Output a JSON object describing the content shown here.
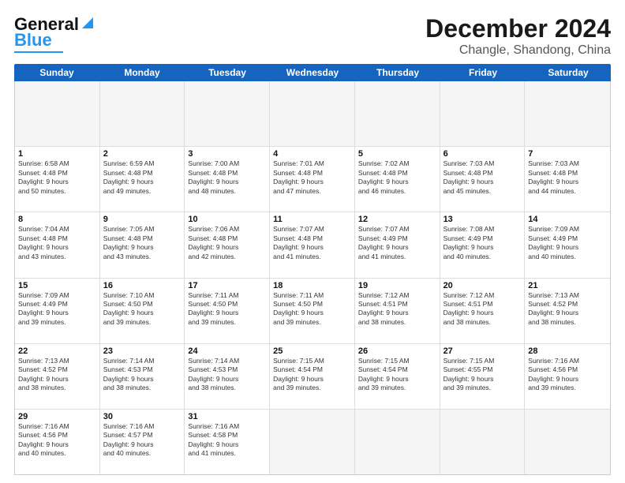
{
  "header": {
    "logo_general": "General",
    "logo_blue": "Blue",
    "main_title": "December 2024",
    "subtitle": "Changle, Shandong, China"
  },
  "calendar": {
    "days_of_week": [
      "Sunday",
      "Monday",
      "Tuesday",
      "Wednesday",
      "Thursday",
      "Friday",
      "Saturday"
    ],
    "weeks": [
      [
        {
          "day": "",
          "text": "",
          "empty": true
        },
        {
          "day": "",
          "text": "",
          "empty": true
        },
        {
          "day": "",
          "text": "",
          "empty": true
        },
        {
          "day": "",
          "text": "",
          "empty": true
        },
        {
          "day": "",
          "text": "",
          "empty": true
        },
        {
          "day": "",
          "text": "",
          "empty": true
        },
        {
          "day": "",
          "text": "",
          "empty": true
        }
      ],
      [
        {
          "day": "1",
          "text": "Sunrise: 6:58 AM\nSunset: 4:48 PM\nDaylight: 9 hours\nand 50 minutes."
        },
        {
          "day": "2",
          "text": "Sunrise: 6:59 AM\nSunset: 4:48 PM\nDaylight: 9 hours\nand 49 minutes."
        },
        {
          "day": "3",
          "text": "Sunrise: 7:00 AM\nSunset: 4:48 PM\nDaylight: 9 hours\nand 48 minutes."
        },
        {
          "day": "4",
          "text": "Sunrise: 7:01 AM\nSunset: 4:48 PM\nDaylight: 9 hours\nand 47 minutes."
        },
        {
          "day": "5",
          "text": "Sunrise: 7:02 AM\nSunset: 4:48 PM\nDaylight: 9 hours\nand 46 minutes."
        },
        {
          "day": "6",
          "text": "Sunrise: 7:03 AM\nSunset: 4:48 PM\nDaylight: 9 hours\nand 45 minutes."
        },
        {
          "day": "7",
          "text": "Sunrise: 7:03 AM\nSunset: 4:48 PM\nDaylight: 9 hours\nand 44 minutes."
        }
      ],
      [
        {
          "day": "8",
          "text": "Sunrise: 7:04 AM\nSunset: 4:48 PM\nDaylight: 9 hours\nand 43 minutes."
        },
        {
          "day": "9",
          "text": "Sunrise: 7:05 AM\nSunset: 4:48 PM\nDaylight: 9 hours\nand 43 minutes."
        },
        {
          "day": "10",
          "text": "Sunrise: 7:06 AM\nSunset: 4:48 PM\nDaylight: 9 hours\nand 42 minutes."
        },
        {
          "day": "11",
          "text": "Sunrise: 7:07 AM\nSunset: 4:48 PM\nDaylight: 9 hours\nand 41 minutes."
        },
        {
          "day": "12",
          "text": "Sunrise: 7:07 AM\nSunset: 4:49 PM\nDaylight: 9 hours\nand 41 minutes."
        },
        {
          "day": "13",
          "text": "Sunrise: 7:08 AM\nSunset: 4:49 PM\nDaylight: 9 hours\nand 40 minutes."
        },
        {
          "day": "14",
          "text": "Sunrise: 7:09 AM\nSunset: 4:49 PM\nDaylight: 9 hours\nand 40 minutes."
        }
      ],
      [
        {
          "day": "15",
          "text": "Sunrise: 7:09 AM\nSunset: 4:49 PM\nDaylight: 9 hours\nand 39 minutes."
        },
        {
          "day": "16",
          "text": "Sunrise: 7:10 AM\nSunset: 4:50 PM\nDaylight: 9 hours\nand 39 minutes."
        },
        {
          "day": "17",
          "text": "Sunrise: 7:11 AM\nSunset: 4:50 PM\nDaylight: 9 hours\nand 39 minutes."
        },
        {
          "day": "18",
          "text": "Sunrise: 7:11 AM\nSunset: 4:50 PM\nDaylight: 9 hours\nand 39 minutes."
        },
        {
          "day": "19",
          "text": "Sunrise: 7:12 AM\nSunset: 4:51 PM\nDaylight: 9 hours\nand 38 minutes."
        },
        {
          "day": "20",
          "text": "Sunrise: 7:12 AM\nSunset: 4:51 PM\nDaylight: 9 hours\nand 38 minutes."
        },
        {
          "day": "21",
          "text": "Sunrise: 7:13 AM\nSunset: 4:52 PM\nDaylight: 9 hours\nand 38 minutes."
        }
      ],
      [
        {
          "day": "22",
          "text": "Sunrise: 7:13 AM\nSunset: 4:52 PM\nDaylight: 9 hours\nand 38 minutes."
        },
        {
          "day": "23",
          "text": "Sunrise: 7:14 AM\nSunset: 4:53 PM\nDaylight: 9 hours\nand 38 minutes."
        },
        {
          "day": "24",
          "text": "Sunrise: 7:14 AM\nSunset: 4:53 PM\nDaylight: 9 hours\nand 38 minutes."
        },
        {
          "day": "25",
          "text": "Sunrise: 7:15 AM\nSunset: 4:54 PM\nDaylight: 9 hours\nand 39 minutes."
        },
        {
          "day": "26",
          "text": "Sunrise: 7:15 AM\nSunset: 4:54 PM\nDaylight: 9 hours\nand 39 minutes."
        },
        {
          "day": "27",
          "text": "Sunrise: 7:15 AM\nSunset: 4:55 PM\nDaylight: 9 hours\nand 39 minutes."
        },
        {
          "day": "28",
          "text": "Sunrise: 7:16 AM\nSunset: 4:56 PM\nDaylight: 9 hours\nand 39 minutes."
        }
      ],
      [
        {
          "day": "29",
          "text": "Sunrise: 7:16 AM\nSunset: 4:56 PM\nDaylight: 9 hours\nand 40 minutes."
        },
        {
          "day": "30",
          "text": "Sunrise: 7:16 AM\nSunset: 4:57 PM\nDaylight: 9 hours\nand 40 minutes."
        },
        {
          "day": "31",
          "text": "Sunrise: 7:16 AM\nSunset: 4:58 PM\nDaylight: 9 hours\nand 41 minutes."
        },
        {
          "day": "",
          "text": "",
          "empty": true
        },
        {
          "day": "",
          "text": "",
          "empty": true
        },
        {
          "day": "",
          "text": "",
          "empty": true
        },
        {
          "day": "",
          "text": "",
          "empty": true
        }
      ]
    ]
  }
}
